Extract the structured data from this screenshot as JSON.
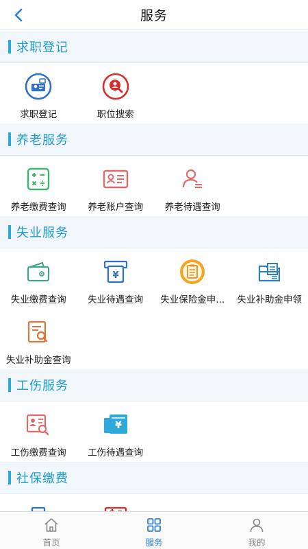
{
  "header": {
    "title": "服务"
  },
  "colors": {
    "accent": "#2fa9d9",
    "tab_active": "#2f7fd0"
  },
  "sections": [
    {
      "title": "求职登记",
      "items": [
        {
          "label": "求职登记",
          "icon": "job-registration-icon"
        },
        {
          "label": "职位搜索",
          "icon": "job-search-icon"
        }
      ]
    },
    {
      "title": "养老服务",
      "items": [
        {
          "label": "养老缴费查询",
          "icon": "calculator-icon"
        },
        {
          "label": "养老账户查询",
          "icon": "id-card-icon"
        },
        {
          "label": "养老待遇查询",
          "icon": "person-list-icon"
        }
      ]
    },
    {
      "title": "失业服务",
      "items": [
        {
          "label": "失业缴费查询",
          "icon": "wallet-icon"
        },
        {
          "label": "失业待遇查询",
          "icon": "yen-atm-icon"
        },
        {
          "label": "失业保险金申...",
          "icon": "clipboard-badge-icon"
        },
        {
          "label": "失业补助金申领",
          "icon": "folder-document-icon"
        },
        {
          "label": "失业补助金查询",
          "icon": "document-search-icon"
        }
      ]
    },
    {
      "title": "工伤服务",
      "items": [
        {
          "label": "工伤缴费查询",
          "icon": "card-search-icon"
        },
        {
          "label": "工伤待遇查询",
          "icon": "yen-receipt-icon"
        }
      ]
    },
    {
      "title": "社保缴费",
      "items": [
        {
          "label": "",
          "icon": "blue-partial-icon"
        },
        {
          "label": "",
          "icon": "red-partial-icon"
        }
      ]
    }
  ],
  "tabbar": [
    {
      "label": "首页",
      "icon": "home-icon",
      "active": false
    },
    {
      "label": "服务",
      "icon": "grid-icon",
      "active": true
    },
    {
      "label": "我的",
      "icon": "user-icon",
      "active": false
    }
  ]
}
